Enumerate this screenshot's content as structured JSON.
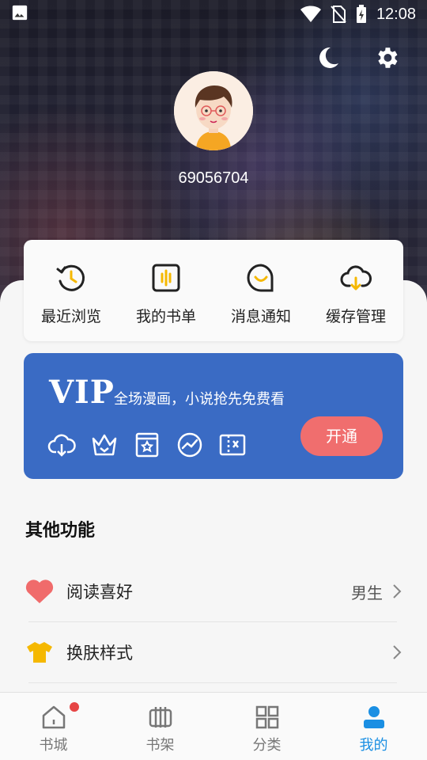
{
  "status_bar": {
    "time": "12:08"
  },
  "profile": {
    "user_id": "69056704"
  },
  "quick_actions": [
    {
      "label": "最近浏览",
      "icon": "history-icon"
    },
    {
      "label": "我的书单",
      "icon": "booklist-icon"
    },
    {
      "label": "消息通知",
      "icon": "message-icon"
    },
    {
      "label": "缓存管理",
      "icon": "cloud-download-icon"
    }
  ],
  "vip": {
    "brand": "VIP",
    "slogan": "全场漫画，小说抢先免费看",
    "button": "开通",
    "perks": [
      "download-icon",
      "crown-icon",
      "book-star-icon",
      "speed-icon",
      "ticket-icon"
    ]
  },
  "other_functions": {
    "title": "其他功能",
    "items": [
      {
        "label": "阅读喜好",
        "value": "男生",
        "icon": "heart-icon"
      },
      {
        "label": "换肤样式",
        "value": "",
        "icon": "tshirt-icon"
      }
    ]
  },
  "tabs": [
    {
      "label": "书城",
      "icon": "home-icon",
      "badge": true
    },
    {
      "label": "书架",
      "icon": "bookshelf-icon"
    },
    {
      "label": "分类",
      "icon": "category-icon"
    },
    {
      "label": "我的",
      "icon": "user-icon",
      "active": true
    }
  ],
  "colors": {
    "vip_bg": "#3a6bc4",
    "open_button": "#f06e6e",
    "accent": "#1a8fe3",
    "heart": "#f06b6b",
    "tshirt": "#f5b800"
  }
}
